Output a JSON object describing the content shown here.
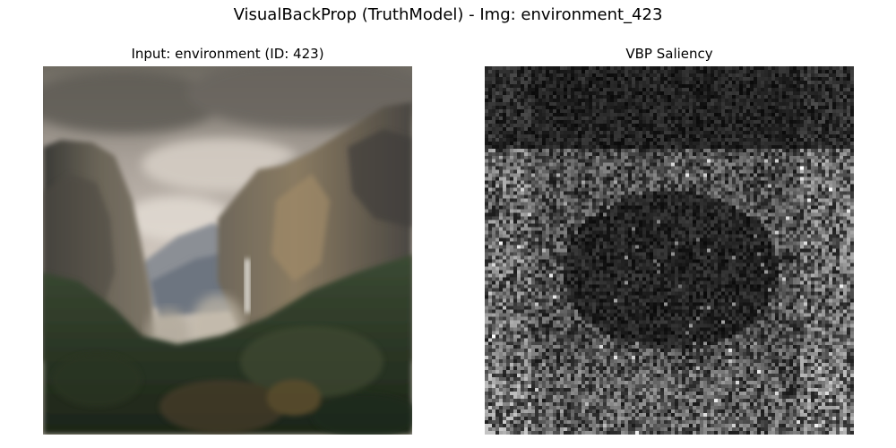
{
  "figure": {
    "title": "VisualBackProp (TruthModel) - Img: environment_423"
  },
  "panels": {
    "input": {
      "title": "Input: environment (ID: 423)"
    },
    "saliency": {
      "title": "VBP Saliency"
    }
  },
  "image_description": {
    "input": "Mountain valley landscape with cloudy sky, granite cliffs, waterfall and dark forest",
    "saliency": "Grayscale noisy saliency map, darker in upper and central region, brighter speckles toward edges and bottom"
  }
}
